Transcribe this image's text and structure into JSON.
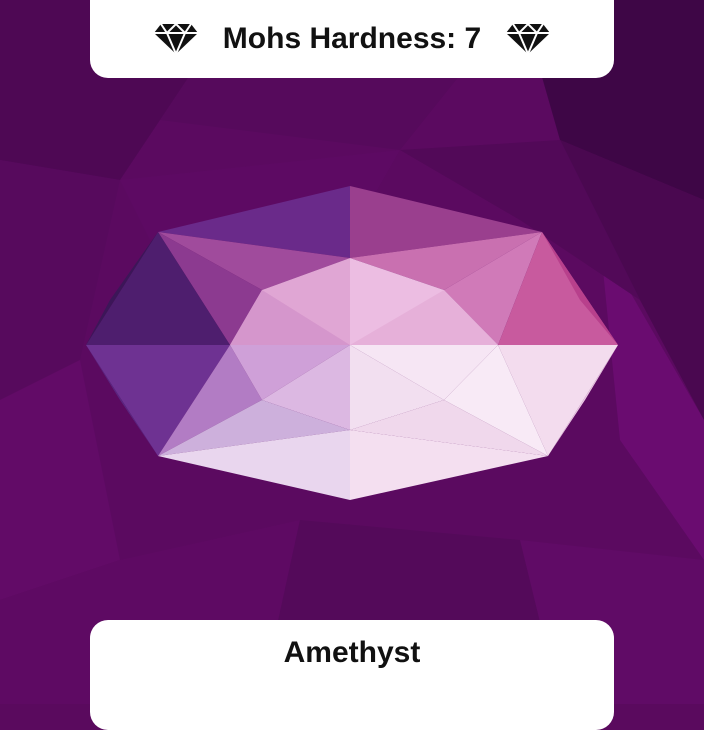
{
  "header": {
    "title": "Mohs Hardness: 7",
    "left_icon": "diamond-icon",
    "right_icon": "diamond-icon"
  },
  "footer": {
    "name": "Amethyst"
  },
  "colors": {
    "background": "#5a0a5e",
    "card": "#ffffff",
    "text": "#111111"
  }
}
